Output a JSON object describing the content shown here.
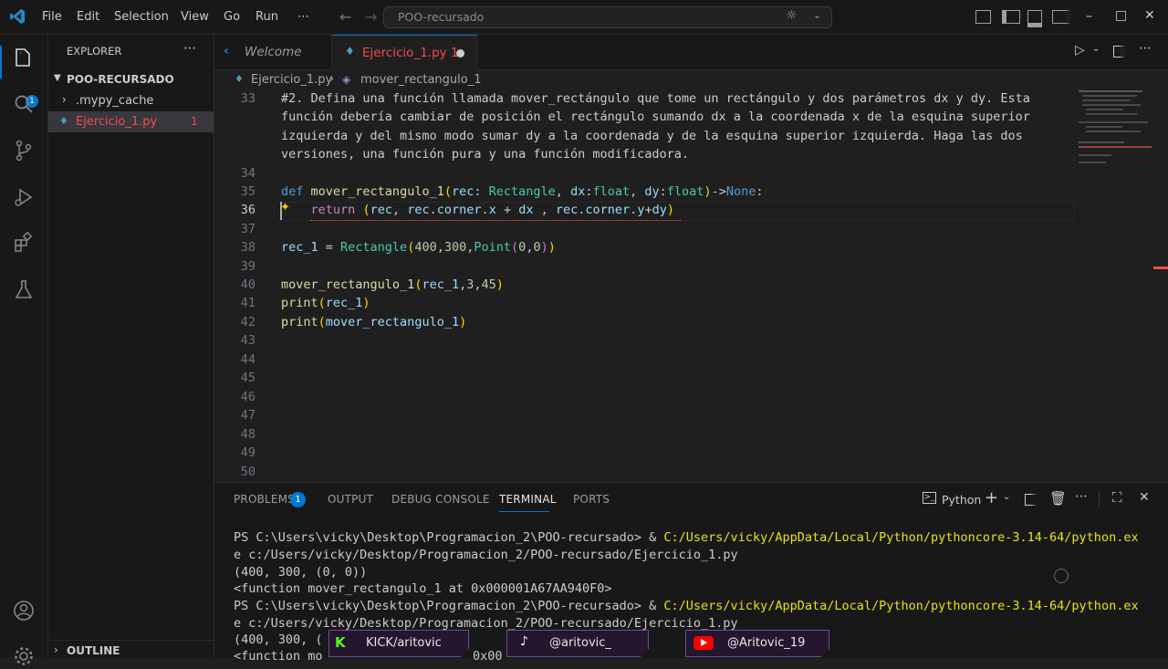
{
  "titlebar": {
    "menus": [
      "File",
      "Edit",
      "Selection",
      "View",
      "Go",
      "Run",
      "⋯"
    ],
    "search": "POO-recursado"
  },
  "sidebar": {
    "title": "EXPLORER",
    "folder": "POO-RECURSADO",
    "items": [
      {
        "label": ".mypy_cache",
        "badge": ""
      },
      {
        "label": "Ejercicio_1.py",
        "badge": "1"
      }
    ],
    "outline": "OUTLINE",
    "explorer_badge": "1"
  },
  "tabs": [
    {
      "label": "Welcome"
    },
    {
      "label": "Ejercicio_1.py 1"
    }
  ],
  "breadcrumb": {
    "file": "Ejercicio_1.py",
    "symbol": "mover_rectangulo_1"
  },
  "editor": {
    "line_numbers": [
      "33",
      "34",
      "35",
      "36",
      "37",
      "38",
      "39",
      "40",
      "41",
      "42",
      "43",
      "44",
      "45",
      "46",
      "47",
      "48",
      "49",
      "50"
    ],
    "comment": [
      "#2. Defina una función llamada mover_rectángulo que tome un rectángulo y dos parámetros dx y dy. Esta",
      "función debería cambiar de posición el rectángulo sumando dx a la coordenada x de la esquina superior",
      "izquierda y del mismo modo sumar dy a la coordenada y de la esquina superior izquierda. Haga las dos",
      "versiones, una función pura y una función modificadora."
    ],
    "code": {
      "l35": "def mover_rectangulo_1(rec: Rectangle, dx:float, dy:float)->None:",
      "l36": "    return (rec, rec.corner.x + dx , rec.corner.y+dy)",
      "l38": "rec_1 = Rectangle(400,300,Point(0,0))",
      "l40": "mover_rectangulo_1(rec_1,3,45)",
      "l41": "print(rec_1)",
      "l42": "print(mover_rectangulo_1)"
    }
  },
  "panel": {
    "tabs": [
      "PROBLEMS",
      "OUTPUT",
      "DEBUG CONSOLE",
      "TERMINAL",
      "PORTS"
    ],
    "problems_badge": "1",
    "shell": "Python",
    "terminal": {
      "prompt1": "PS C:\\Users\\vicky\\Desktop\\Programacion_2\\POO-recursado> & ",
      "exe1": "C:/Users/vicky/AppData/Local/Python/pythoncore-3.14-64/python.ex",
      "cont1": "e c:/Users/vicky/Desktop/Programacion_2/POO-recursado/Ejercicio_1.py",
      "out1": "(400, 300, (0, 0))",
      "out2": "<function mover_rectangulo_1 at 0x000001A67AA940F0>",
      "prompt2": "PS C:\\Users\\vicky\\Desktop\\Programacion_2\\POO-recursado> & ",
      "exe2": "C:/Users/vicky/AppData/Local/Python/pythoncore-3.14-64/python.ex",
      "cont2": "e c:/Users/vicky/Desktop/Programacion_2/POO-recursado/Ejercicio_1.py",
      "out3": "(400, 300, (",
      "out4": "<function mo",
      "out4b": "0x00"
    }
  },
  "overlay": {
    "kick": "KICK/aritovic",
    "tiktok": "@aritovic_",
    "youtube": "@Aritovic_19"
  },
  "colors": {
    "accent": "#0078d4",
    "error": "#f14c4c",
    "modified_tab": "#e2c08d"
  }
}
